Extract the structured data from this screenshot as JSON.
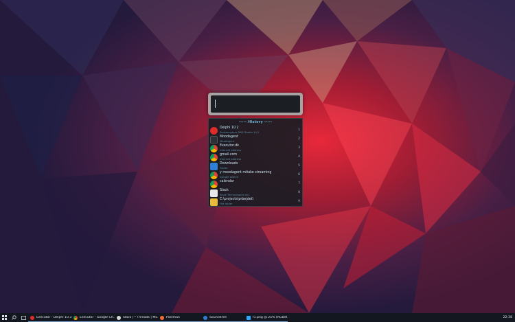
{
  "launcher": {
    "search": {
      "value": "",
      "placeholder": ""
    },
    "history": {
      "header": "----- History -----",
      "items": [
        {
          "title": "Delphi 10.2",
          "subtitle": "Embarcadero RAD Studio 10.2",
          "num": "1",
          "icon": "delphi-rx-icon",
          "color": "#e02b2b"
        },
        {
          "title": "Moodagent",
          "subtitle": "Moodagent",
          "num": "2",
          "icon": "moodagent-icon",
          "color": "#2b2f36"
        },
        {
          "title": "Executor.dk",
          "subtitle": "Internet address",
          "num": "3",
          "icon": "chrome-icon",
          "color": "#e8c11a"
        },
        {
          "title": "gmail.com",
          "subtitle": "Internet address",
          "num": "4",
          "icon": "chrome-icon",
          "color": "#e8c11a"
        },
        {
          "title": "Downloads",
          "subtitle": "Folder",
          "num": "5",
          "icon": "download-folder-icon",
          "color": "#2f7fd6"
        },
        {
          "title": "y moodagent mitake streaming",
          "subtitle": "Google search",
          "num": "6",
          "icon": "chrome-icon",
          "color": "#e8c11a"
        },
        {
          "title": "calendar",
          "subtitle": "",
          "num": "7",
          "icon": "chrome-icon",
          "color": "#e8c11a"
        },
        {
          "title": "Slack",
          "subtitle": "Slack Technologies Inc.",
          "num": "8",
          "icon": "slack-icon",
          "color": "#e9e9e9"
        },
        {
          "title": "C:\\projects\\prbejdet\\",
          "subtitle": "File folder",
          "num": "9",
          "icon": "folder-icon",
          "color": "#e8b93a"
        }
      ]
    }
  },
  "taskbar": {
    "items": [
      {
        "label": "Executor - Delphi 10.3...",
        "icon": "delphi-rx-icon",
        "color": "#e02b2b",
        "active": true
      },
      {
        "label": "Executor - Google Ch...",
        "icon": "chrome-icon",
        "color": "#e8c11a",
        "active": true
      },
      {
        "label": "Slack | * Threads | Mo...",
        "icon": "slack-icon",
        "color": "#d8d8d8",
        "active": true
      },
      {
        "label": "Postman",
        "icon": "postman-icon",
        "color": "#ef6c34",
        "active": true
      },
      {
        "label": "Sourcetree",
        "icon": "sourcetree-icon",
        "color": "#2f7fd6",
        "active": true
      },
      {
        "label": "f1.png @ 25% (RGB/8...",
        "icon": "photoshop-icon",
        "color": "#31a8ff",
        "active": true
      }
    ],
    "clock": "22:38"
  }
}
